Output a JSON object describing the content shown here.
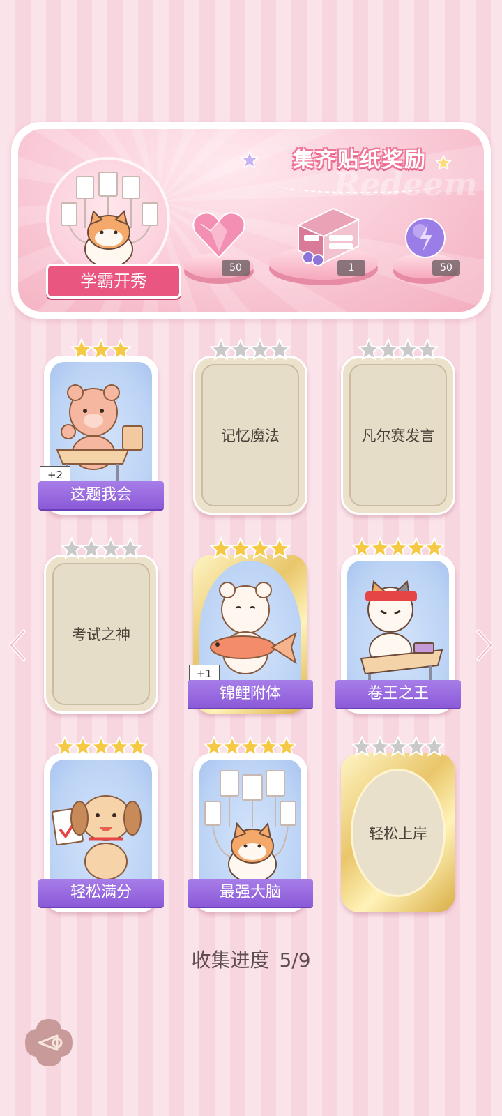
{
  "banner": {
    "title": "集齐贴纸奖励",
    "watermark": "Redeem",
    "feature_label": "学霸开秀",
    "rewards": [
      {
        "icon": "pink-heart-gem-icon",
        "count": "50"
      },
      {
        "icon": "gift-box-icon",
        "count": "1"
      },
      {
        "icon": "purple-energy-orb-icon",
        "count": "50"
      }
    ]
  },
  "cards": [
    {
      "title": "这题我会",
      "stars_total": 3,
      "stars_earned": 3,
      "state": "unlocked",
      "badge": "+2",
      "art": "bear-at-desk"
    },
    {
      "title": "记忆魔法",
      "stars_total": 4,
      "stars_earned": 0,
      "state": "locked"
    },
    {
      "title": "凡尔赛发言",
      "stars_total": 4,
      "stars_earned": 0,
      "state": "locked"
    },
    {
      "title": "考试之神",
      "stars_total": 4,
      "stars_earned": 0,
      "state": "locked"
    },
    {
      "title": "锦鲤附体",
      "stars_total": 4,
      "stars_earned": 4,
      "state": "unlocked-gold",
      "badge": "+1",
      "art": "bear-holding-koi"
    },
    {
      "title": "卷王之王",
      "stars_total": 5,
      "stars_earned": 5,
      "state": "unlocked",
      "art": "cat-studying"
    },
    {
      "title": "轻松满分",
      "stars_total": 5,
      "stars_earned": 5,
      "state": "unlocked",
      "art": "dog-full-score"
    },
    {
      "title": "最强大脑",
      "stars_total": 5,
      "stars_earned": 5,
      "state": "unlocked",
      "art": "cat-with-papers"
    },
    {
      "title": "轻松上岸",
      "stars_total": 5,
      "stars_earned": 0,
      "state": "locked-gold"
    }
  ],
  "progress": {
    "label": "收集进度",
    "value": "5/9"
  },
  "colors": {
    "accent_pink": "#e9567f",
    "label_purple": "#8b5ad8",
    "star_gold": "#f6c945",
    "star_gray": "#c9c9c9"
  }
}
